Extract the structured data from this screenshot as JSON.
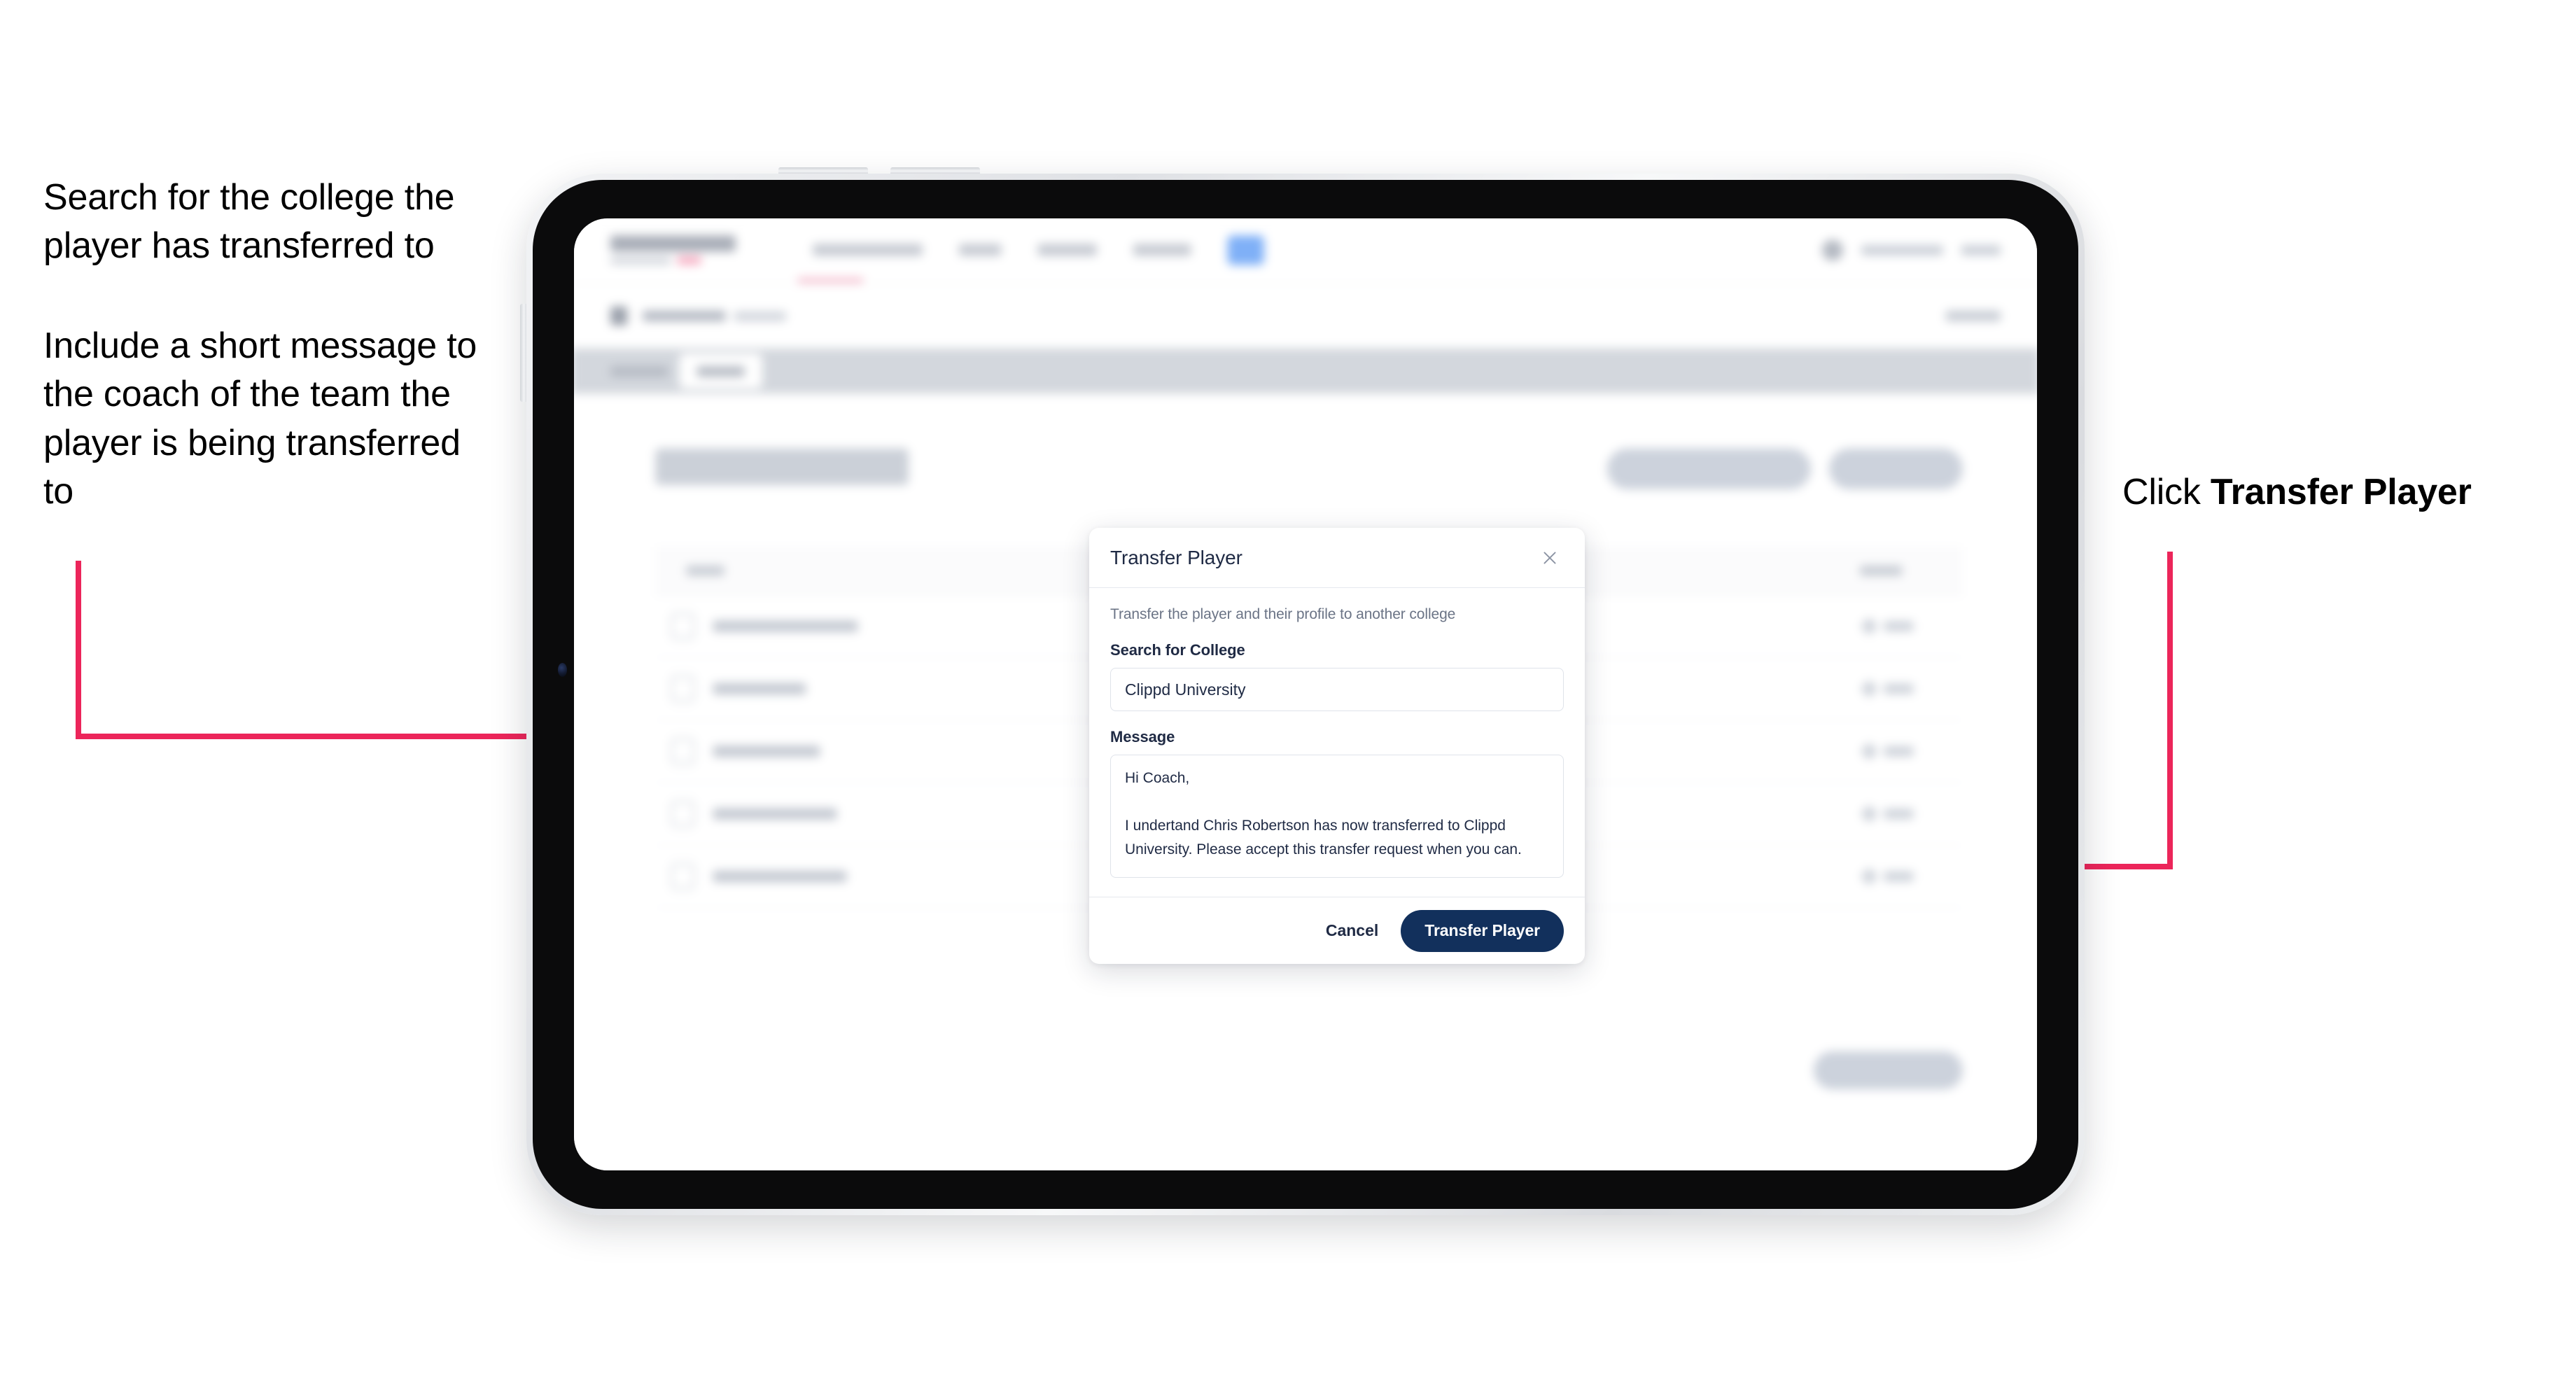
{
  "annotations": {
    "left": [
      "Search for the college the player has transferred to",
      "Include a short message to the coach of the team the player is being transferred to"
    ],
    "right_prefix": "Click ",
    "right_strong": "Transfer Player",
    "arrow_color": "#ec255a"
  },
  "app": {
    "page_title": "Update Roster",
    "brand": "SCOREBOARD",
    "breadcrumb": "Scoreboard",
    "tab_active": "Roster"
  },
  "modal": {
    "title": "Transfer Player",
    "close_icon": "close-icon",
    "description": "Transfer the player and their profile to another college",
    "college_label": "Search for College",
    "college_value": "Clippd University",
    "college_placeholder": "Search for College",
    "message_label": "Message",
    "message_value": "Hi Coach,\n\nI undertand Chris Robertson has now transferred to Clippd University. Please accept this transfer request when you can.",
    "message_placeholder": "Message",
    "cancel_label": "Cancel",
    "submit_label": "Transfer Player",
    "primary_color": "#12305c"
  }
}
